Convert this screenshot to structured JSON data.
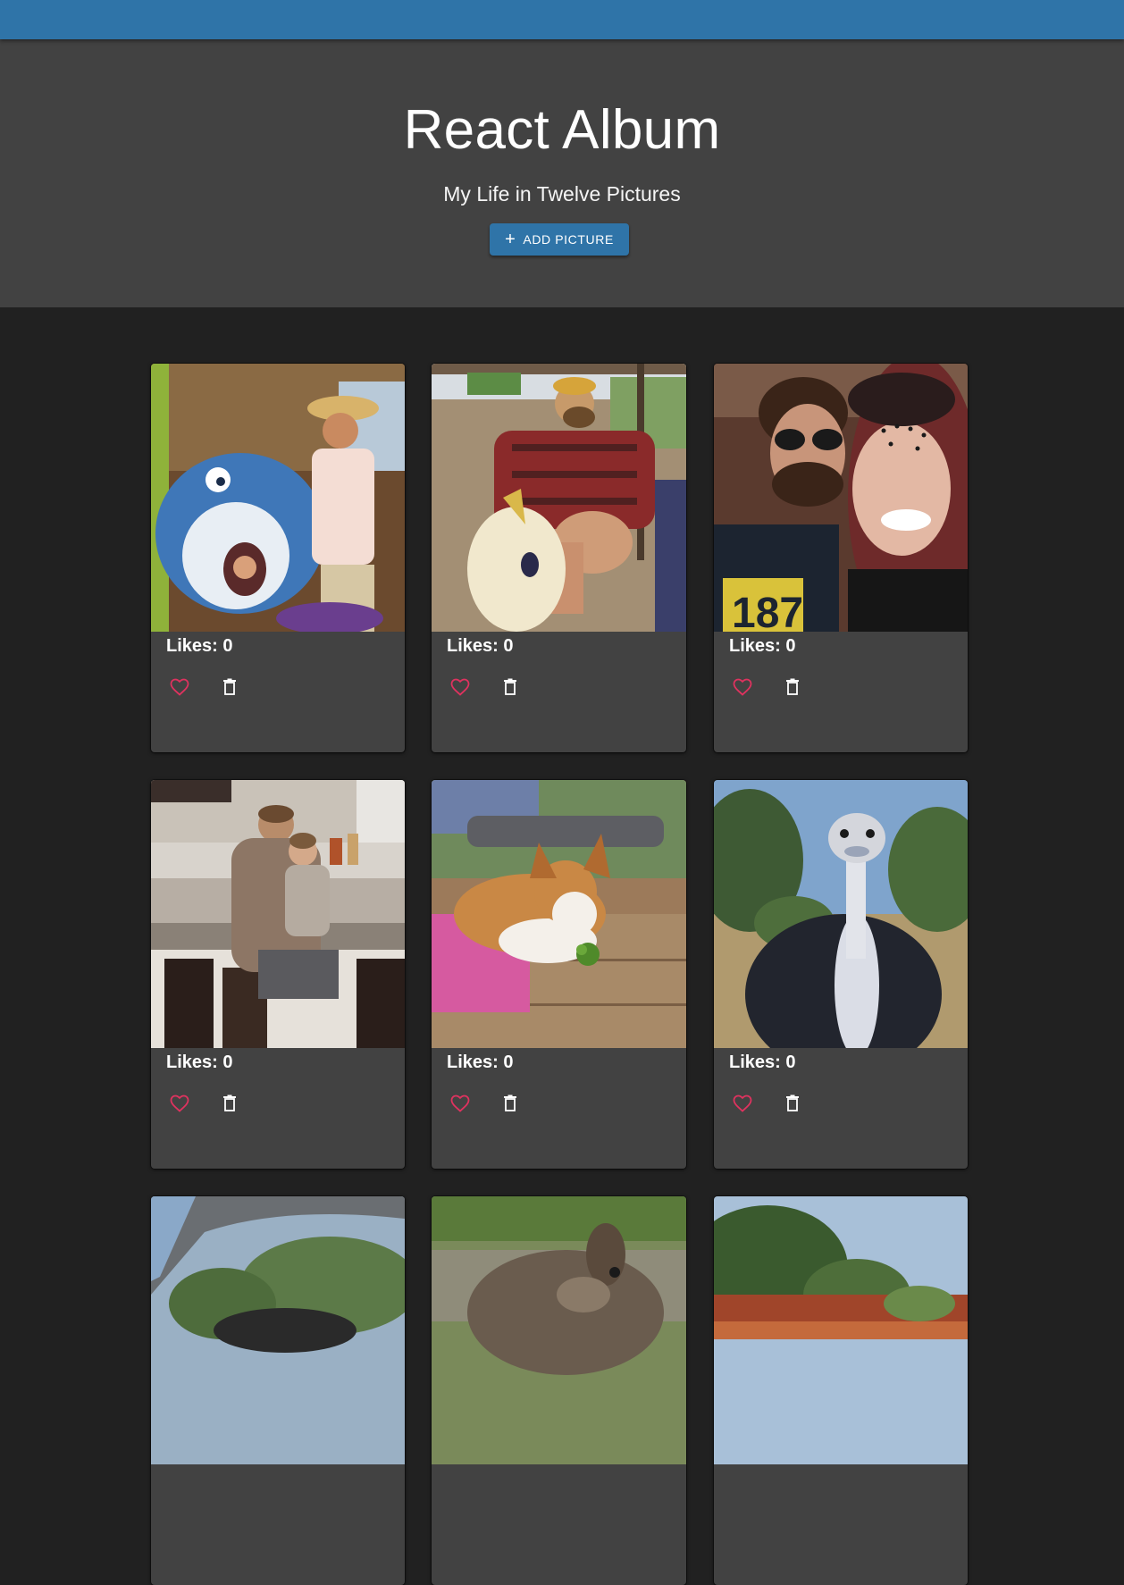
{
  "header": {
    "title": "React Album",
    "subtitle": "My Life in Twelve Pictures",
    "add_button_label": "ADD PICTURE",
    "add_button_icon": "plus-icon"
  },
  "colors": {
    "appbar": "#2f74a8",
    "hero_background": "#424242",
    "page_background": "#212121",
    "card_background": "#424242",
    "like_icon": "#e0325f"
  },
  "pictures": [
    {
      "likes_text": "Likes: 0",
      "likes": 0,
      "subject": "man with shark cutout"
    },
    {
      "likes_text": "Likes: 0",
      "likes": 0,
      "subject": "man on toy horse"
    },
    {
      "likes_text": "Likes: 0",
      "likes": 0,
      "subject": "couple selfie"
    },
    {
      "likes_text": "Likes: 0",
      "likes": 0,
      "subject": "father and daughter in kitchen"
    },
    {
      "likes_text": "Likes: 0",
      "likes": 0,
      "subject": "corgi puppy with broccoli"
    },
    {
      "likes_text": "Likes: 0",
      "likes": 0,
      "subject": "ostrich"
    },
    {
      "likes_text": "",
      "likes": null,
      "subject": "dog under car"
    },
    {
      "likes_text": "",
      "likes": null,
      "subject": "donkey"
    },
    {
      "likes_text": "",
      "likes": null,
      "subject": "red rock coastline"
    }
  ],
  "card_icons": {
    "like": "heart-outline-icon",
    "delete": "trash-icon"
  }
}
